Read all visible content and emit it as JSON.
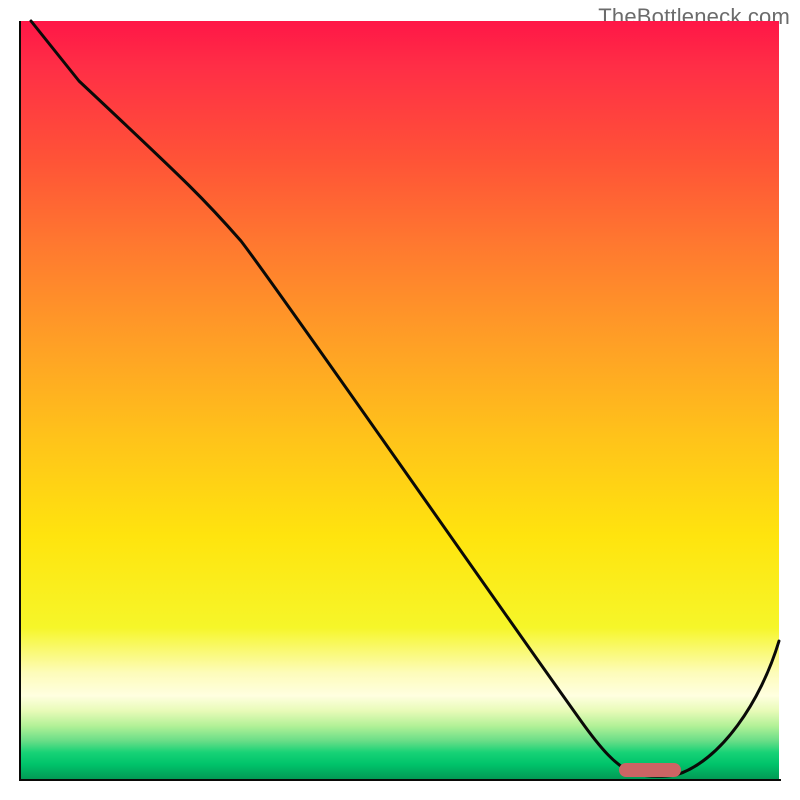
{
  "watermark": "TheBottleneck.com",
  "chart_data": {
    "type": "line",
    "title": "",
    "xlabel": "",
    "ylabel": "",
    "xlim": [
      0,
      100
    ],
    "ylim": [
      0,
      100
    ],
    "x": [
      0,
      7,
      24,
      30,
      40,
      50,
      60,
      70,
      76,
      80,
      84,
      86,
      100
    ],
    "y": [
      100,
      92,
      77,
      71,
      57,
      43,
      29,
      14,
      5,
      1,
      0,
      0,
      20
    ],
    "optimal_range": {
      "x_start": 79,
      "x_end": 87,
      "y": 0.2
    },
    "gradient_stops": [
      {
        "pos": 0.0,
        "color": "#ff1647"
      },
      {
        "pos": 0.5,
        "color": "#ffc31a"
      },
      {
        "pos": 0.85,
        "color": "#fdfcba"
      },
      {
        "pos": 1.0,
        "color": "#029a55"
      }
    ]
  }
}
